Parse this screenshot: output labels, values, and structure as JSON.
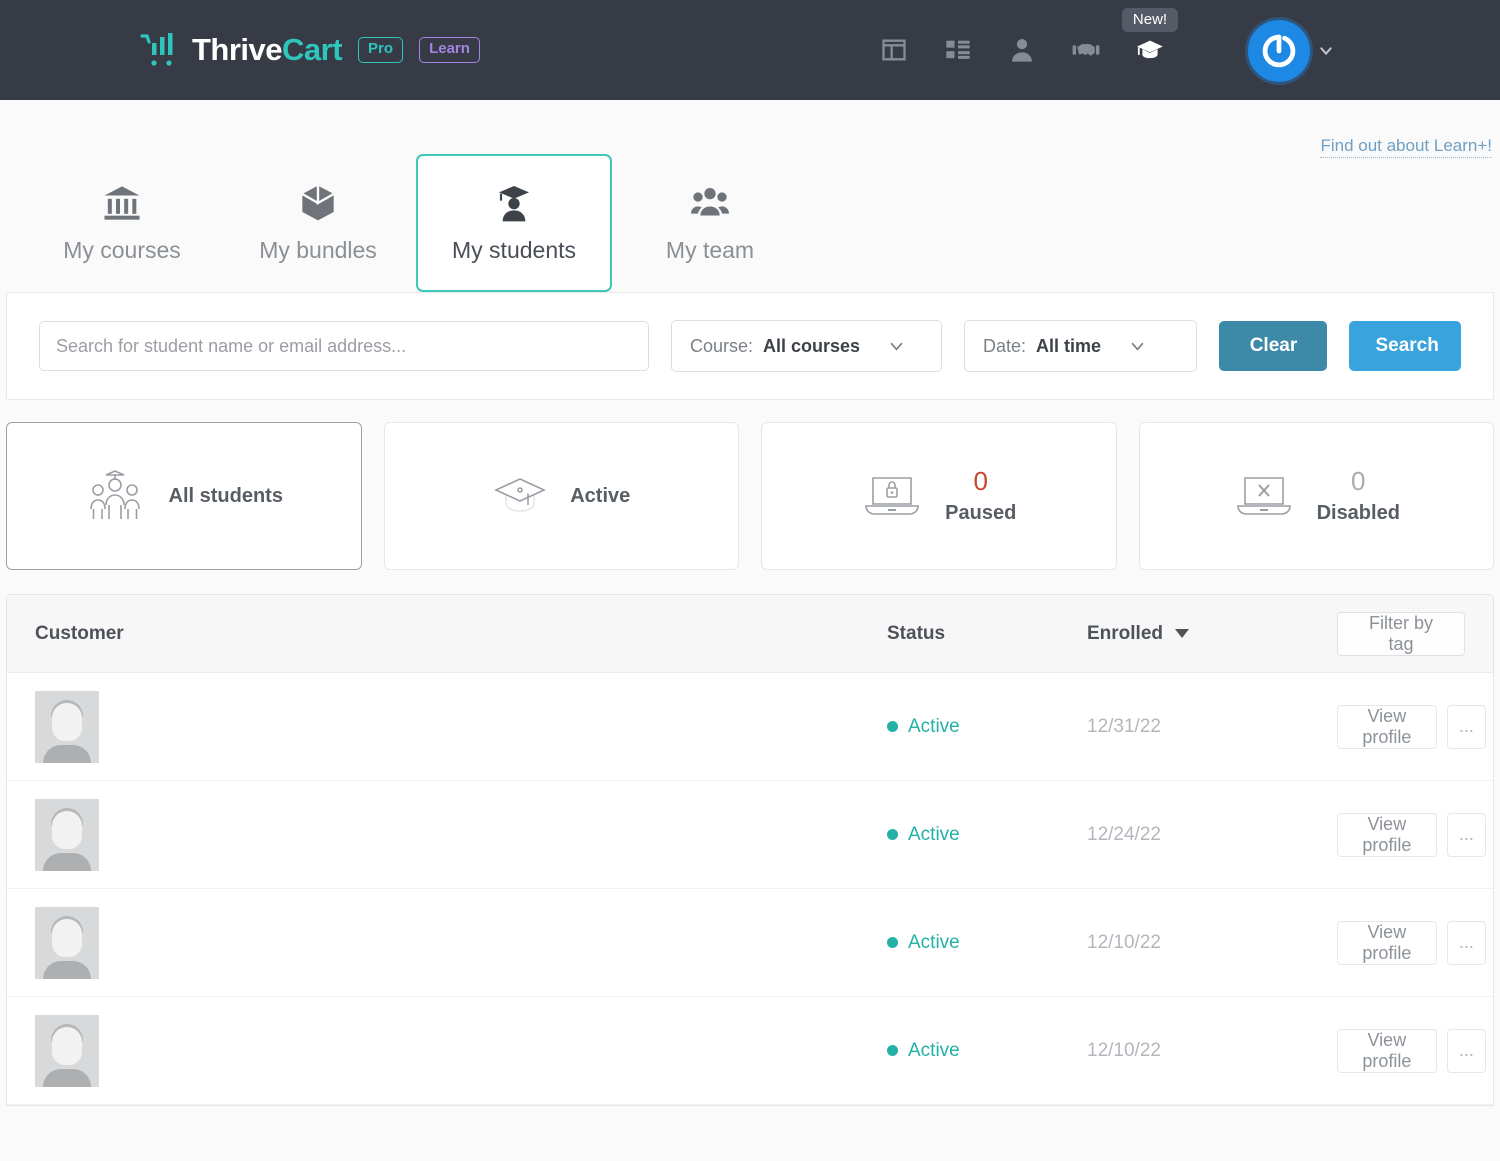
{
  "header": {
    "brand": {
      "thrive": "Thrive",
      "cart": "Cart",
      "pro_chip": "Pro",
      "learn_chip": "Learn"
    },
    "nav_icons": [
      {
        "name": "layout-icon",
        "label": "Dashboard"
      },
      {
        "name": "list-icon",
        "label": "Products"
      },
      {
        "name": "person-icon",
        "label": "Customers"
      },
      {
        "name": "handshake-icon",
        "label": "Affiliates"
      },
      {
        "name": "graduation-cap-icon",
        "label": "Learn",
        "badge": "New!"
      }
    ],
    "avatar": {
      "name": "account-avatar"
    }
  },
  "learn_plus": {
    "link_text": "Find out about Learn+!"
  },
  "tabs": [
    {
      "label": "My courses",
      "icon": "bank-icon",
      "active": false
    },
    {
      "label": "My bundles",
      "icon": "box-icon",
      "active": false
    },
    {
      "label": "My students",
      "icon": "student-icon",
      "active": true
    },
    {
      "label": "My team",
      "icon": "team-icon",
      "active": false
    }
  ],
  "search": {
    "placeholder": "Search for student name or email address...",
    "value": "",
    "course_label": "Course:",
    "course_value": "All courses",
    "date_label": "Date:",
    "date_value": "All time",
    "clear_label": "Clear",
    "search_label": "Search"
  },
  "stat_cards": [
    {
      "label": "All students",
      "count": "",
      "icon": "students-group-icon",
      "selected": true,
      "count_color": ""
    },
    {
      "label": "Active",
      "count": "",
      "icon": "graduation-cap-outline-icon",
      "selected": false,
      "count_color": ""
    },
    {
      "label": "Paused",
      "count": "0",
      "icon": "laptop-lock-icon",
      "selected": false,
      "count_color": "#c4492b"
    },
    {
      "label": "Disabled",
      "count": "0",
      "icon": "laptop-x-icon",
      "selected": false,
      "count_color": "#a8acb2"
    }
  ],
  "table": {
    "columns": {
      "customer": "Customer",
      "status": "Status",
      "enrolled": "Enrolled"
    },
    "filter_tag_label": "Filter by tag",
    "row_actions": {
      "view_profile": "View profile",
      "more": "..."
    },
    "rows": [
      {
        "customer": "",
        "status": "Active",
        "enrolled": "12/31/22"
      },
      {
        "customer": "",
        "status": "Active",
        "enrolled": "12/24/22"
      },
      {
        "customer": "",
        "status": "Active",
        "enrolled": "12/10/22"
      },
      {
        "customer": "",
        "status": "Active",
        "enrolled": "12/10/22"
      }
    ]
  },
  "colors": {
    "header_bg": "#363b45",
    "teal_accent": "#3ec6b8",
    "status_teal": "#23b0a6",
    "search_blue": "#38a3dd",
    "clear_blue": "#3d8aa8",
    "avatar_blue": "#1e88e5",
    "paused_red": "#c4492b",
    "learn_purple": "#a583e0"
  }
}
